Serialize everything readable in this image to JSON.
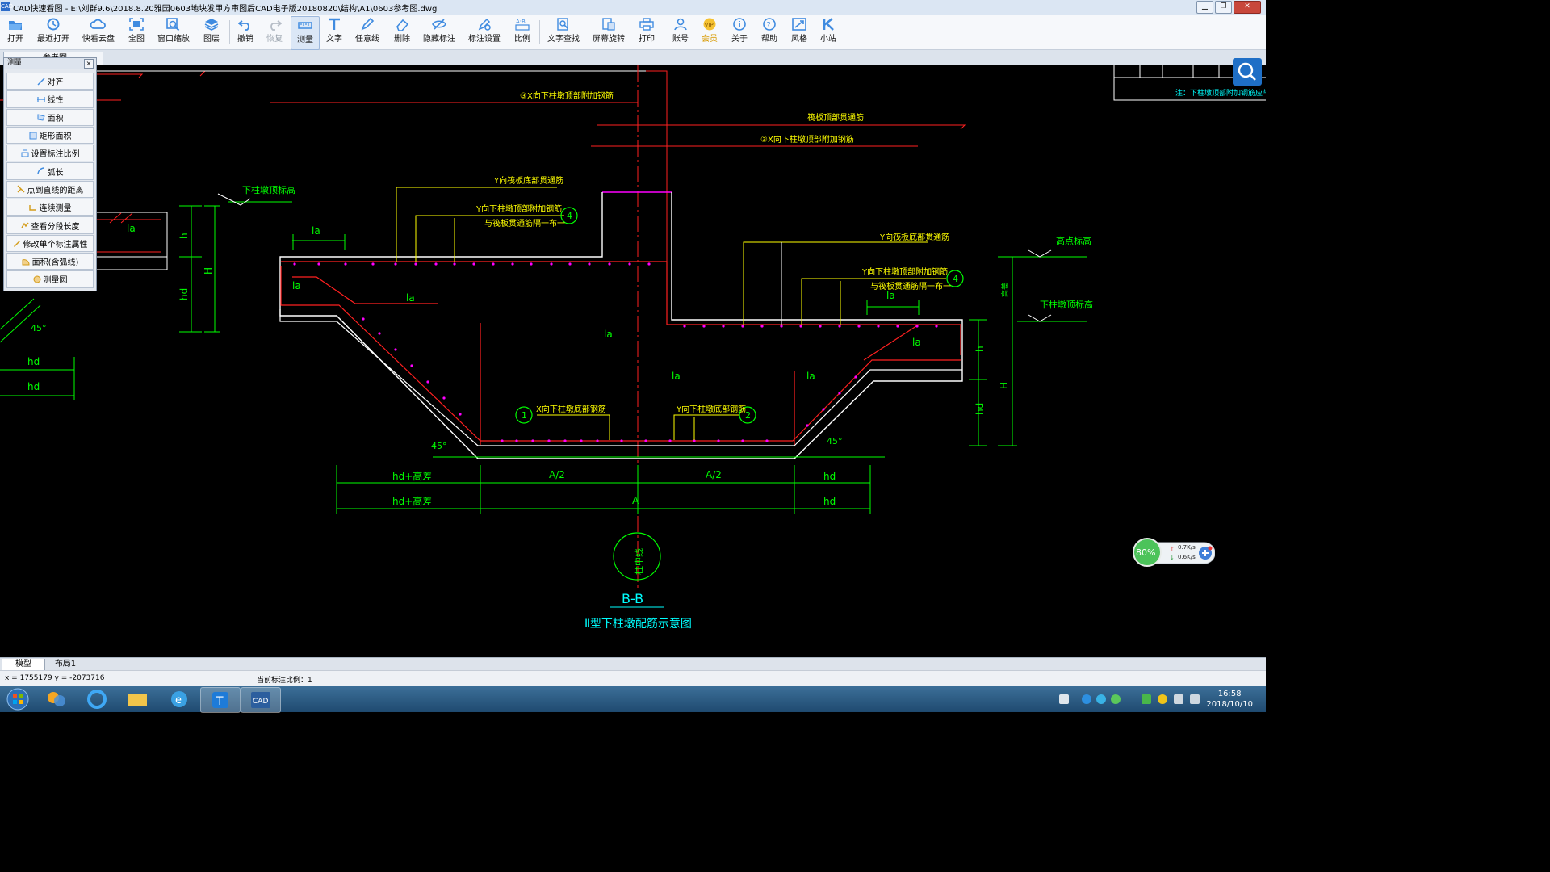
{
  "window": {
    "title": "CAD快速看图 - E:\\刘群9.6\\2018.8.20雅园0603地块发甲方审图后CAD电子版20180820\\结构\\A1\\0603参考图.dwg",
    "app_icon_text": "CAD",
    "buttons": [
      "minimize-icon",
      "maximize-icon",
      "close-icon"
    ]
  },
  "toolbar": {
    "items": [
      {
        "label": "打开",
        "icon": "folder-open-icon"
      },
      {
        "label": "最近打开",
        "icon": "history-icon"
      },
      {
        "label": "快看云盘",
        "icon": "cloud-icon"
      },
      {
        "label": "全图",
        "icon": "fit-all-icon"
      },
      {
        "label": "窗口缩放",
        "icon": "zoom-window-icon"
      },
      {
        "label": "图层",
        "icon": "layers-icon"
      },
      {
        "label": "撤销",
        "icon": "undo-icon"
      },
      {
        "label": "恢复",
        "icon": "redo-icon"
      },
      {
        "label": "测量",
        "icon": "measure-icon"
      },
      {
        "label": "文字",
        "icon": "text-icon"
      },
      {
        "label": "任意线",
        "icon": "pen-icon"
      },
      {
        "label": "删除",
        "icon": "eraser-icon"
      },
      {
        "label": "隐藏标注",
        "icon": "hide-icon"
      },
      {
        "label": "标注设置",
        "icon": "annotation-settings-icon"
      },
      {
        "label": "比例",
        "icon": "scale-icon"
      },
      {
        "label": "文字查找",
        "icon": "text-search-icon"
      },
      {
        "label": "屏幕旋转",
        "icon": "rotate-icon"
      },
      {
        "label": "打印",
        "icon": "print-icon"
      },
      {
        "label": "账号",
        "icon": "account-icon"
      },
      {
        "label": "会员",
        "icon": "vip-icon"
      },
      {
        "label": "关于",
        "icon": "info-icon"
      },
      {
        "label": "帮助",
        "icon": "help-icon"
      },
      {
        "label": "风格",
        "icon": "style-icon"
      },
      {
        "label": "小站",
        "icon": "site-icon"
      }
    ],
    "active": "测量",
    "disabled": [
      "恢复"
    ],
    "vip_color": "#d89a00"
  },
  "doc_tab": {
    "label": "参考图"
  },
  "measure_panel": {
    "title": "测量",
    "close": "×",
    "items": [
      {
        "label": "对齐",
        "icon": "align-measure-icon"
      },
      {
        "label": "线性",
        "icon": "linear-measure-icon"
      },
      {
        "label": "面积",
        "icon": "area-icon"
      },
      {
        "label": "矩形面积",
        "icon": "rect-area-icon"
      },
      {
        "label": "设置标注比例",
        "icon": "annotation-scale-icon"
      },
      {
        "label": "弧长",
        "icon": "arc-length-icon"
      },
      {
        "label": "点到直线的距离",
        "icon": "point-line-distance-icon"
      },
      {
        "label": "连续测量",
        "icon": "continuous-measure-icon"
      },
      {
        "label": "查看分段长度",
        "icon": "segment-length-icon"
      },
      {
        "label": "修改单个标注属性",
        "icon": "edit-annotation-icon"
      },
      {
        "label": "面积(含弧线)",
        "icon": "arc-area-icon"
      },
      {
        "label": "测量圆",
        "icon": "circle-measure-icon"
      }
    ]
  },
  "drawing": {
    "labels": {
      "x_top_rebar": "③X向下柱墩顶部附加钢筋",
      "raft_top_rebar": "筏板顶部贯通筋",
      "x_top_rebar_2": "③X向下柱墩顶部附加钢筋",
      "y_raft_bottom_left": "Y向筏板底部贯通筋",
      "y_col_top_add_left": "Y向下柱墩顶部附加钢筋",
      "same_as_raft_left": "与筏板贯通筋隔一布一",
      "y_raft_bottom_right": "Y向筏板底部贯通筋",
      "y_col_top_add_right": "Y向下柱墩顶部附加钢筋",
      "same_as_raft_right": "与筏板贯通筋隔一布一",
      "col_top_elev_left": "下柱墩顶标高",
      "high_point_elev": "高点标高",
      "col_top_elev_right": "下柱墩顶标高",
      "x_col_bottom": "X向下柱墩底部钢筋",
      "y_col_bottom": "Y向下柱墩底部钢筋",
      "h": "h",
      "H": "H",
      "hd": "hd",
      "la": "la",
      "angle": "45°",
      "dim_hd_plus_diff": "hd+高差",
      "dim_a_half": "A/2",
      "dim_a": "A",
      "dim_hd": "hd",
      "center_symbol": "柱中线",
      "elev_diff": "高差",
      "circle_1": "1",
      "circle_2": "2",
      "circle_4": "4",
      "section": "B-B",
      "section_title": "Ⅱ型下柱墩配筋示意图",
      "note_right": "注：下柱墩顶部附加钢筋应与筏板顶部"
    },
    "colors": {
      "green": "#00ff00",
      "red": "#ff2020",
      "yellow": "#ffff00",
      "white": "#ffffff",
      "magenta": "#ff00ff",
      "cyan": "#00ffff"
    }
  },
  "net_widget": {
    "percent": "80%",
    "up": "0.7K/s",
    "down": "0.6K/s"
  },
  "layout_tabs": [
    {
      "label": "模型"
    },
    {
      "label": "布局1"
    }
  ],
  "status": {
    "coords": "x = 1755179  y = -2073716",
    "scale": "当前标注比例：1"
  },
  "taskbar": {
    "time": "16:58",
    "date": "2018/10/10"
  }
}
